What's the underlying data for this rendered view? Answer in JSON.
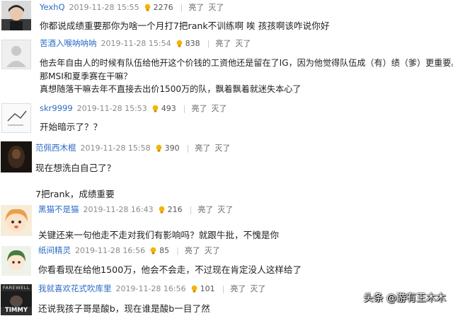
{
  "comments": [
    {
      "user": "YexhQ",
      "date": "2019-11-28 15:55",
      "likes": "2276",
      "act_light": "亮了",
      "act_dim": "灭了",
      "lines": [
        "你都说成绩重要那你为啥一个月打7把rank不训练啊 唉 孩孩啊该咋说你好"
      ]
    },
    {
      "user": "苦酒入喉呐呐呐",
      "date": "2019-11-28 15:54",
      "likes": "838",
      "act_light": "亮了",
      "act_dim": "灭了",
      "lines": [
        "他去年自由人的时候有队伍给他开这个价钱的工资他还是留在了IG，因为他觉得队伍成（有）绩（爹）更重要。",
        "那MSI和夏季赛在干嘛？",
        "真想随落干嘛去年不直接去出价1500万的队，飘着飘着就迷失本心了"
      ]
    },
    {
      "user": "skr9999",
      "date": "2019-11-28 15:53",
      "likes": "493",
      "act_light": "亮了",
      "act_dim": "灭了",
      "lines": [
        "开始暗示了？？"
      ]
    },
    {
      "user": "范佩西木棍",
      "date": "2019-11-28 15:58",
      "likes": "390",
      "act_light": "亮了",
      "act_dim": "灭了",
      "lines": [
        "现在想洗白自己了？",
        "",
        "7把rank，成绩重要"
      ]
    },
    {
      "user": "黑猫不是猫",
      "date": "2019-11-28 16:43",
      "likes": "216",
      "act_light": "亮了",
      "act_dim": "灭了",
      "lines": [
        "关键还来一句他走不走对我们有影响吗？就跟牛批，不愧是你"
      ]
    },
    {
      "user": "纸间精灵",
      "date": "2019-11-28 16:56",
      "likes": "85",
      "act_light": "亮了",
      "act_dim": "灭了",
      "lines": [
        "你看看现在给他1500万，他会不会走，不过现在肯定没人这样给了"
      ]
    },
    {
      "user": "我就喜欢花式吹库里",
      "date": "2019-11-28 16:56",
      "likes": "101",
      "act_light": "亮了",
      "act_dim": "灭了",
      "lines": [
        "还说我孩子哥是酸b，现在谁是酸b一目了然"
      ]
    }
  ],
  "avatar_texts": {
    "farewell": "FAREWELL",
    "timmy": "TIMMY"
  },
  "watermark": "头条 @游有王木木",
  "colors": {
    "username": "#2b6cc4",
    "date": "#8a8a8a",
    "text": "#1f1f1f",
    "bulb": "#f5b400"
  }
}
